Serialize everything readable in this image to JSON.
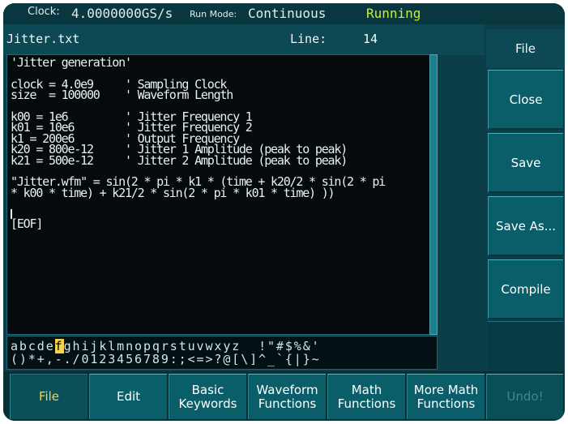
{
  "status_bar": {
    "clock_label": "Clock:",
    "clock_value": "4.0000000GS/s",
    "run_mode_label": "Run Mode:",
    "run_mode_value": "Continuous",
    "run_state": "Running"
  },
  "editor": {
    "filename": "Jitter.txt",
    "line_label": "Line:",
    "line_value": "14",
    "lines": [
      "'Jitter generation'",
      "",
      "clock = 4.0e9     ' Sampling Clock",
      "size  = 100000    ' Waveform Length",
      "",
      "k00 = 1e6         ' Jitter Frequency 1",
      "k01 = 10e6        ' Jitter Frequency 2",
      "k1 = 200e6        ' Output Frequency",
      "k20 = 800e-12     ' Jitter 1 Amplitude (peak to peak)",
      "k21 = 500e-12     ' Jitter 2 Amplitude (peak to peak)",
      "",
      "\"Jitter.wfm\" = sin(2 * pi * k1 * (time + k20/2 * sin(2 * pi",
      "* k00 * time) + k21/2 * sin(2 * pi * k01 * time) ))",
      "",
      "[EOF]"
    ]
  },
  "char_picker": {
    "row1_before": "abcde",
    "row1_selected": "f",
    "row1_after": "ghijklmnopqrstuvwxyz  !\"#$%&'",
    "row2": "()*+,-./0123456789:;<=>?@[\\]^_`{|}~"
  },
  "side_panel": {
    "title": "File",
    "buttons": [
      "Close",
      "Save",
      "Save As...",
      "Compile"
    ]
  },
  "tabs": [
    {
      "label": "File"
    },
    {
      "label": "Edit"
    },
    {
      "label": "Basic\nKeywords"
    },
    {
      "label": "Waveform\nFunctions"
    },
    {
      "label": "Math\nFunctions"
    },
    {
      "label": "More Math\nFunctions"
    },
    {
      "label": "Undo!"
    }
  ],
  "colors": {
    "background": "#0b3e47",
    "button": "#0a5e69",
    "running": "#c9ef2a",
    "selected_tab_text": "#f4d44a"
  }
}
